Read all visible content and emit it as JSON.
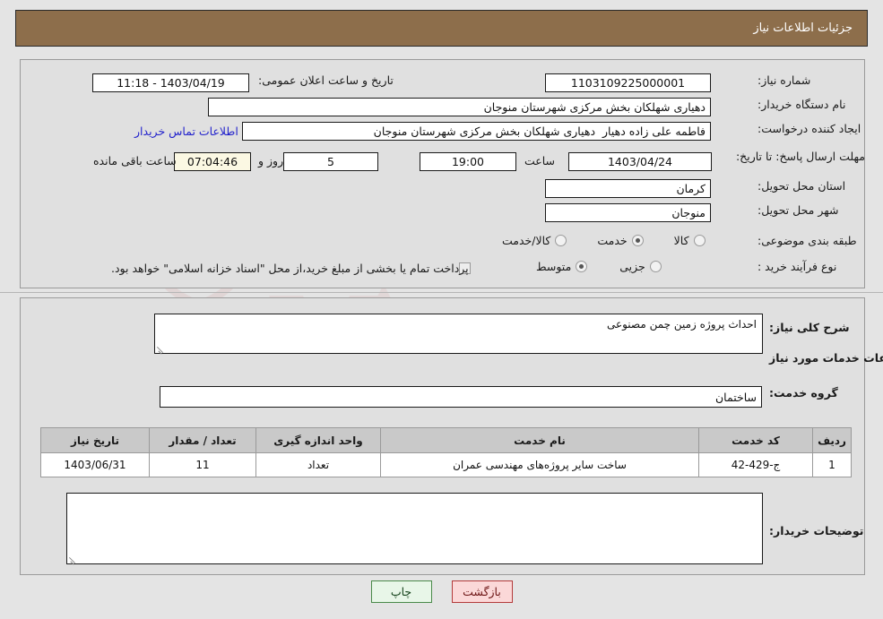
{
  "header": {
    "title": "جزئیات اطلاعات نیاز"
  },
  "form": {
    "need_number_label": "شماره نیاز:",
    "need_number_value": "1103109225000001",
    "announce_label": "تاریخ و ساعت اعلان عمومی:",
    "announce_value": "1403/04/19 - 11:18",
    "buyer_org_label": "نام دستگاه خریدار:",
    "buyer_org_value": "دهیاری شهلکان بخش مرکزی شهرستان منوجان",
    "requester_label": "ایجاد کننده درخواست:",
    "requester_value": "فاطمه علی زاده دهیار  دهیاری شهلکان بخش مرکزی شهرستان منوجان",
    "contact_link": "اطلاعات تماس خریدار",
    "deadline_label": "مهلت ارسال پاسخ: تا تاریخ:",
    "deadline_date": "1403/04/24",
    "hour_label": "ساعت",
    "deadline_time": "19:00",
    "days_remaining": "5",
    "days_sep_label": "روز و",
    "countdown": "07:04:46",
    "remaining_suffix": "ساعت باقی مانده",
    "province_label": "استان محل تحویل:",
    "province_value": "کرمان",
    "city_label": "شهر محل تحویل:",
    "city_value": "منوجان",
    "category_label": "طبقه بندی موضوعی:",
    "category_options": [
      {
        "label": "کالا",
        "selected": false
      },
      {
        "label": "خدمت",
        "selected": true
      },
      {
        "label": "کالا/خدمت",
        "selected": false
      }
    ],
    "process_label": "نوع فرآیند خرید :",
    "process_options": [
      {
        "label": "جزیی",
        "selected": false
      },
      {
        "label": "متوسط",
        "selected": true
      }
    ],
    "treasury_checkbox_checked": false,
    "treasury_text": "پرداخت تمام یا بخشی از مبلغ خرید،از محل \"اسناد خزانه اسلامی\" خواهد بود."
  },
  "details": {
    "general_desc_label": "شرح کلی نیاز:",
    "general_desc_value": "احداث پروژه زمین چمن مصنوعی",
    "services_heading": "اطلاعات خدمات مورد نیاز",
    "service_group_label": "گروه خدمت:",
    "service_group_value": "ساختمان",
    "buyer_notes_label": "توضیحات خریدار:",
    "buyer_notes_value": ""
  },
  "table": {
    "columns": [
      "ردیف",
      "کد خدمت",
      "نام خدمت",
      "واحد اندازه گیری",
      "تعداد / مقدار",
      "تاریخ نیاز"
    ],
    "rows": [
      {
        "row_no": "1",
        "service_code": "ج-429-42",
        "service_name": "ساخت سایر پروژه‌های مهندسی عمران",
        "unit": "تعداد",
        "quantity": "11",
        "need_date": "1403/06/31"
      }
    ]
  },
  "buttons": {
    "print_label": "چاپ",
    "back_label": "بازگشت"
  },
  "watermark": {
    "text": "AriaTender.net"
  },
  "colors": {
    "header_bg": "#8d6e4b",
    "page_bg": "#e4e4e4",
    "panel_bg": "#e0e0e0",
    "link": "#2222cc",
    "table_header_bg": "#c9c9c9",
    "countdown_bg": "#fbf8e3",
    "print_btn_bg": "#e8f6e8",
    "back_btn_bg": "#fbd8d8"
  }
}
